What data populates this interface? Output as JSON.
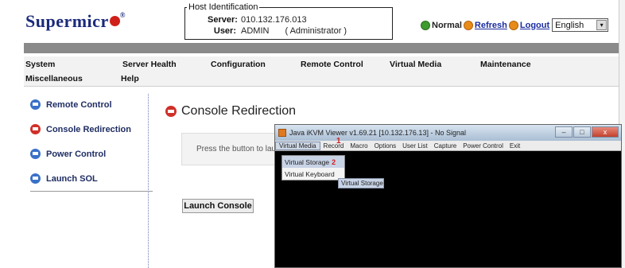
{
  "brand": {
    "logo_text": "Supermicr",
    "logo_reg": "®"
  },
  "host": {
    "legend": "Host Identification",
    "server_label": "Server:",
    "server_value": "010.132.176.013",
    "user_label": "User:",
    "user_value": "ADMIN",
    "role_value": "( Administrator )"
  },
  "status": {
    "normal_label": "Normal",
    "refresh_label": "Refresh",
    "logout_label": "Logout",
    "language_value": "English"
  },
  "nav": {
    "items": [
      "System",
      "Server Health",
      "Configuration",
      "Remote Control",
      "Virtual Media",
      "Maintenance",
      "Miscellaneous",
      "Help"
    ]
  },
  "sidebar": {
    "items": [
      {
        "label": "Remote Control",
        "icon": "arrow-right-icon"
      },
      {
        "label": "Console Redirection",
        "icon": "arrow-right-icon"
      },
      {
        "label": "Power Control",
        "icon": "arrow-right-icon"
      },
      {
        "label": "Launch SOL",
        "icon": "arrow-right-icon"
      }
    ]
  },
  "content": {
    "title": "Console Redirection",
    "press_text": "Press the button to laun",
    "launch_button": "Launch Console"
  },
  "kvm": {
    "title": "Java iKVM Viewer v1.69.21 [10.132.176.13] - No Signal",
    "menu": [
      "Virtual Media",
      "Record",
      "Macro",
      "Options",
      "User List",
      "Capture",
      "Power Control",
      "Exit"
    ],
    "menu_marker": "1",
    "dropdown": [
      "Virtual Storage",
      "Virtual Keyboard"
    ],
    "dropdown_marker": "2",
    "submenu": "Virtual Storage",
    "win_buttons": [
      "–",
      "□",
      "x"
    ]
  },
  "colors": {
    "brand_blue": "#1b2a7a",
    "brand_red": "#d03028",
    "link_blue": "#1a2ca0",
    "status_green": "#3e9b2e"
  }
}
